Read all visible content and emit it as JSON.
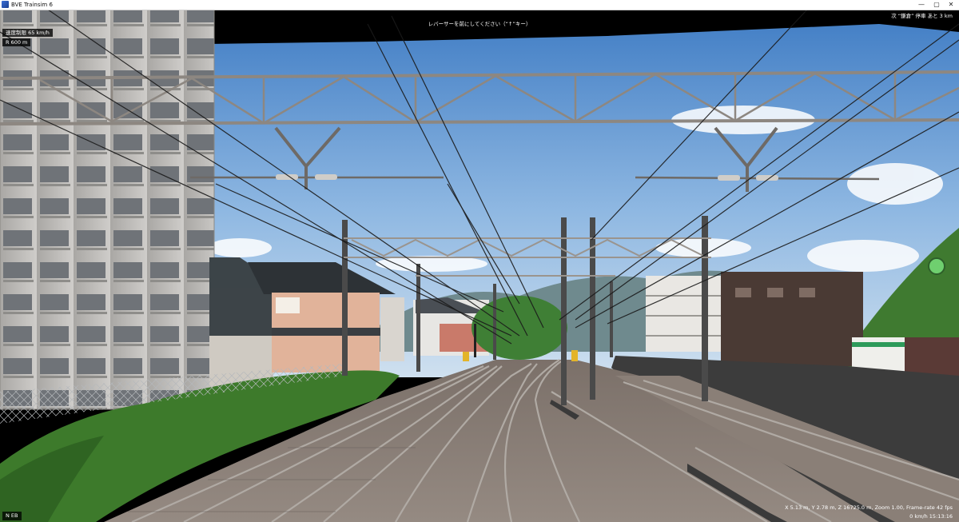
{
  "window": {
    "title": "BVE Trainsim 6",
    "minimize": "—",
    "maximize": "▢",
    "close": "✕",
    "icon": "bve-app-icon"
  },
  "hud": {
    "speed_limit": "速度制限 65 km/h",
    "curve_radius": "R 600 m",
    "notice": "レバーサーを前にしてください（“↑”キー）",
    "next_station": "次 “鎌倉” 停車 あと 3 km",
    "reverser": "N  EB",
    "stats": "X 5.13 m, Y 2.78 m, Z 16725.0 m, Zoom 1.00, Frame-rate 42 fps",
    "speed_clock": "0 km/h  15:13:16"
  },
  "scene": {
    "colors": {
      "sky_top": "#4d86c8",
      "sky_bottom": "#b9d3ec",
      "gantry": "#8d8781",
      "ballast": "#8e8278",
      "rail": "#9a948e",
      "platform": "#3d3d3d",
      "vegetation": "#3e7a2c"
    }
  }
}
